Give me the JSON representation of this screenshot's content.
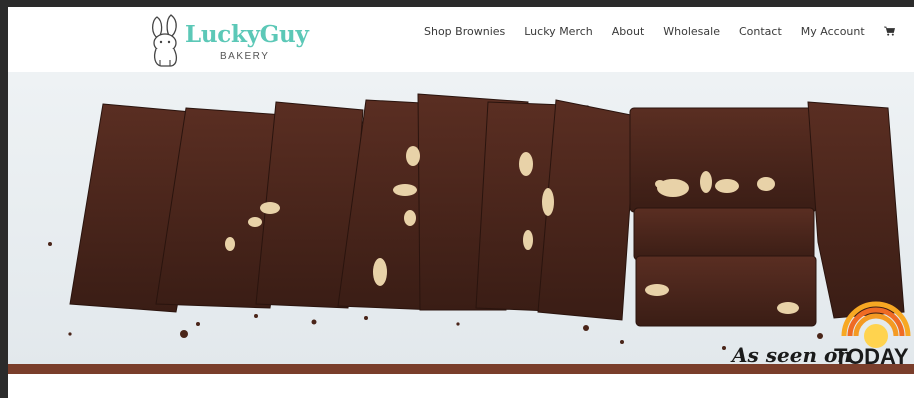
{
  "brand": {
    "name": "LuckyGuy",
    "tagline": "BAKERY",
    "color": "#5cc8b7"
  },
  "nav": {
    "items": [
      {
        "label": "Shop Brownies"
      },
      {
        "label": "Lucky Merch"
      },
      {
        "label": "About"
      },
      {
        "label": "Wholesale"
      },
      {
        "label": "Contact"
      },
      {
        "label": "My Account"
      }
    ],
    "cart_icon": "cart-icon"
  },
  "hero": {
    "badge_script": "As seen on",
    "badge_logo": "TODAY",
    "colors": {
      "brownie": "#3d1f17",
      "brownie_top": "#5a2e22",
      "walnut": "#e8d2a8",
      "background": "#e9eef1"
    }
  }
}
